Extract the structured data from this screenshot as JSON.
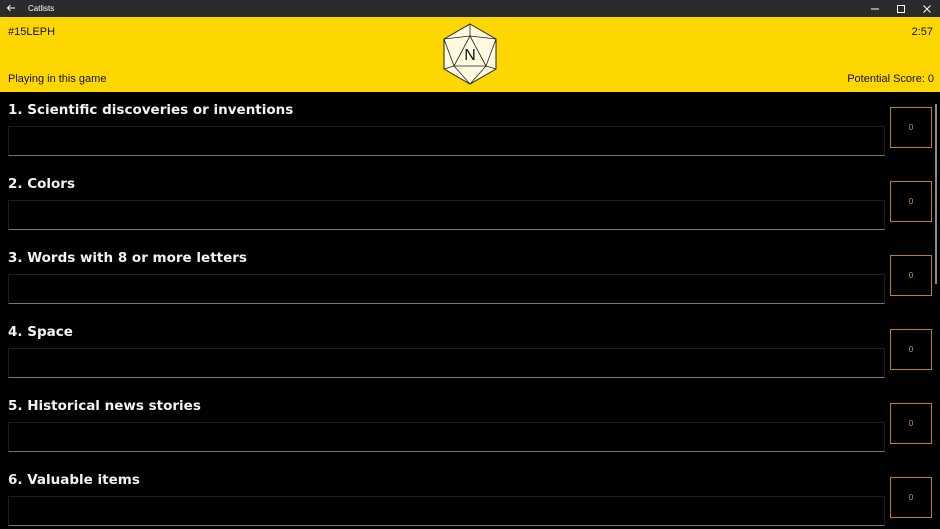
{
  "window": {
    "title": "Catlists",
    "controls": [
      "minimize-icon",
      "maximize-icon",
      "close-icon"
    ]
  },
  "header": {
    "game_id": "#15LEPH",
    "timer": "2:57",
    "status": "Playing in this game",
    "potential_label": "Potential Score:",
    "potential_value": "0",
    "die_letter": "N",
    "background": "#ffd700"
  },
  "categories": [
    {
      "label": "1. Scientific discoveries or inventions",
      "value": "",
      "score": "0"
    },
    {
      "label": "2. Colors",
      "value": "",
      "score": "0"
    },
    {
      "label": "3. Words with 8 or more letters",
      "value": "",
      "score": "0"
    },
    {
      "label": "4. Space",
      "value": "",
      "score": "0"
    },
    {
      "label": "5. Historical news stories",
      "value": "",
      "score": "0"
    },
    {
      "label": "6. Valuable items",
      "value": "",
      "score": "0"
    }
  ],
  "colors": {
    "accent": "#ffd700",
    "score_border": "#b8860b",
    "background": "#000000"
  }
}
